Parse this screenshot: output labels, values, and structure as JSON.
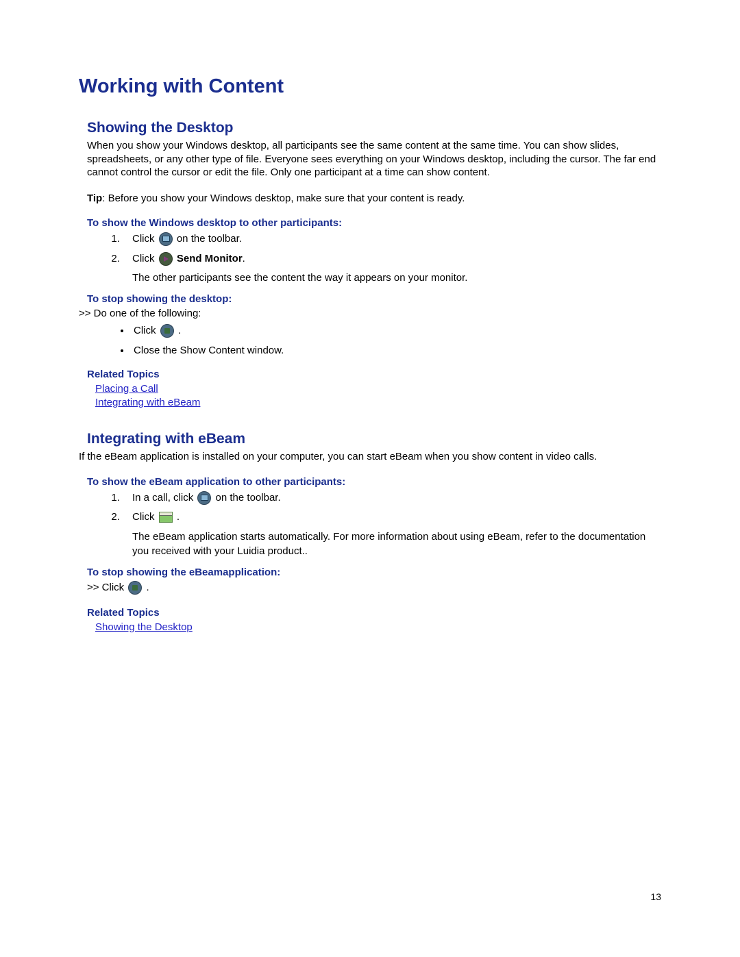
{
  "title": "Working with Content",
  "section1": {
    "heading": "Showing the Desktop",
    "intro": "When you show your Windows desktop, all participants see the same content at the same time. You can show slides, spreadsheets, or any other type of file. Everyone sees everything on your Windows desktop, including the cursor. The far end cannot control the cursor or edit the file. Only one participant at a time can show content.",
    "tip_label": "Tip",
    "tip_text": ": Before you show your Windows desktop, make sure that your content is ready.",
    "show_heading": "To show the Windows desktop to other participants:",
    "step1_a": "Click ",
    "step1_b": " on the toolbar.",
    "step2_a": "Click ",
    "step2_bold": "Send Monitor",
    "step2_b": ".",
    "result": "The other participants see the content the way it appears on your monitor.",
    "stop_heading": "To stop showing the desktop:",
    "stop_intro": ">> Do one of the following:",
    "bullet1_a": "Click ",
    "bullet1_b": " .",
    "bullet2": "Close the Show Content window.",
    "related_heading": "Related Topics",
    "link1": "Placing a Call",
    "link2": "Integrating with eBeam"
  },
  "section2": {
    "heading": "Integrating with eBeam",
    "intro": "If the eBeam application is installed on your computer, you can start eBeam when you show content in video calls.",
    "show_heading": "To show the eBeam application to other participants:",
    "step1_a": "In a call, click ",
    "step1_b": " on the toolbar.",
    "step2_a": "Click ",
    "step2_b": " .",
    "result": "The eBeam application starts automatically. For more information about using eBeam, refer to the documentation you received with your Luidia product..",
    "stop_heading": "To stop showing the eBeamapplication:",
    "stop_line_a": ">> Click ",
    "stop_line_b": " .",
    "related_heading": "Related Topics",
    "link1": "Showing the Desktop"
  },
  "page_number": "13"
}
